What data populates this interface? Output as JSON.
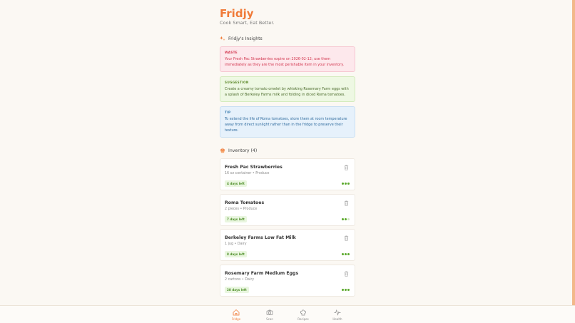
{
  "app": {
    "name": "Fridjy",
    "tagline": "Cook Smart, Eat Better."
  },
  "insights": {
    "title": "Fridjy's Insights",
    "items": [
      {
        "tag": "WASTE",
        "text": "Your Fresh Pac Strawberries expire on 2026-02-12; use them immediately as they are the most perishable item in your inventory."
      },
      {
        "tag": "SUGGESTION",
        "text": "Create a creamy tomato omelet by whisking Rosemary Farm eggs with a splash of Berkeley Farms milk and folding in diced Roma tomatoes."
      },
      {
        "tag": "TIP",
        "text": "To extend the life of Roma tomatoes, store them at room temperature away from direct sunlight rather than in the fridge to preserve their texture."
      }
    ]
  },
  "inventory": {
    "title": "Inventory (4)",
    "items": [
      {
        "name": "Fresh Pac Strawberries",
        "meta": "16 oz container • Produce",
        "badge": "4 days left",
        "freshness_level": 3
      },
      {
        "name": "Roma Tomatoes",
        "meta": "2 pieces • Produce",
        "badge": "7 days left",
        "freshness_level": 2
      },
      {
        "name": "Berkeley Farms Low Fat Milk",
        "meta": "1 jug • Dairy",
        "badge": "8 days left",
        "freshness_level": 3
      },
      {
        "name": "Rosemary Farm Medium Eggs",
        "meta": "2 cartons • Dairy",
        "badge": "28 days left",
        "freshness_level": 3
      }
    ]
  },
  "nav": {
    "items": [
      {
        "label": "Fridge",
        "icon": "home-icon",
        "active": true
      },
      {
        "label": "Scan",
        "icon": "camera-icon",
        "active": false
      },
      {
        "label": "Recipes",
        "icon": "chef-hat-icon",
        "active": false
      },
      {
        "label": "Health",
        "icon": "pulse-icon",
        "active": false
      }
    ]
  },
  "colors": {
    "accent": "#f07a38",
    "waste": "#d2364f",
    "suggestion": "#5e8a2c",
    "tip": "#3579ad",
    "fresh": "#5aa82a"
  }
}
